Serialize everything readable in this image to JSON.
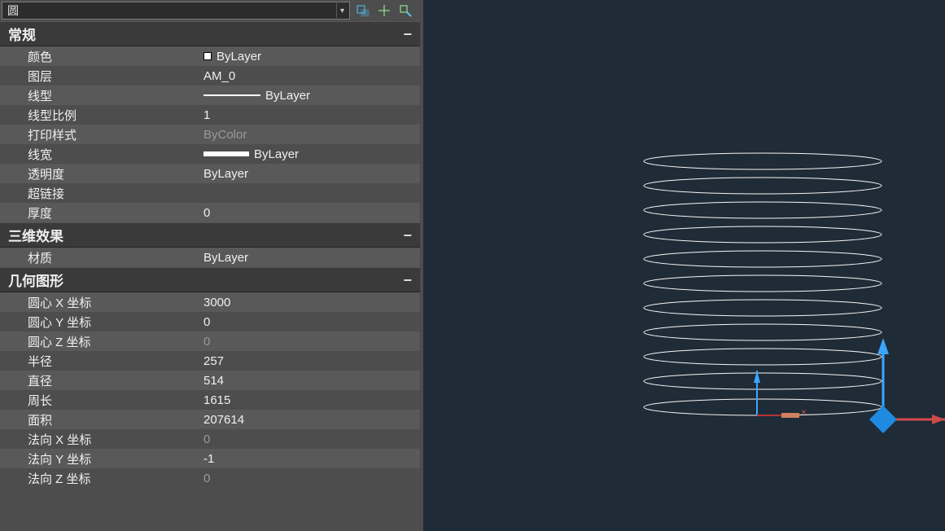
{
  "objectType": "圆",
  "sections": {
    "general": {
      "title": "常规",
      "props": {
        "color_label": "颜色",
        "color_value": "ByLayer",
        "layer_label": "图层",
        "layer_value": "AM_0",
        "linetype_label": "线型",
        "linetype_value": "ByLayer",
        "ltscale_label": "线型比例",
        "ltscale_value": "1",
        "plotstyle_label": "打印样式",
        "plotstyle_value": "ByColor",
        "lineweight_label": "线宽",
        "lineweight_value": "ByLayer",
        "transparency_label": "透明度",
        "transparency_value": "ByLayer",
        "hyperlink_label": "超链接",
        "hyperlink_value": "",
        "thickness_label": "厚度",
        "thickness_value": "0"
      }
    },
    "threeD": {
      "title": "三维效果",
      "props": {
        "material_label": "材质",
        "material_value": "ByLayer"
      }
    },
    "geometry": {
      "title": "几何图形",
      "props": {
        "cx_label": "圆心 X 坐标",
        "cx_value": "3000",
        "cy_label": "圆心 Y 坐标",
        "cy_value": "0",
        "cz_label": "圆心 Z 坐标",
        "cz_value": "0",
        "radius_label": "半径",
        "radius_value": "257",
        "diameter_label": "直径",
        "diameter_value": "514",
        "circum_label": "周长",
        "circum_value": "1615",
        "area_label": "面积",
        "area_value": "207614",
        "nx_label": "法向 X 坐标",
        "nx_value": "0",
        "ny_label": "法向 Y 坐标",
        "ny_value": "-1",
        "nz_label": "法向 Z 坐标",
        "nz_value": "0"
      }
    }
  }
}
